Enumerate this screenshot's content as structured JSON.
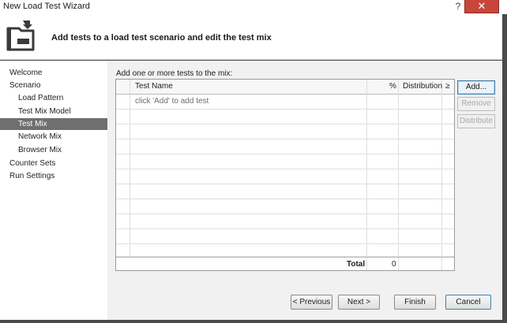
{
  "window": {
    "title": "New Load Test Wizard",
    "help_glyph": "?",
    "close_glyph": "✕"
  },
  "header": {
    "heading": "Add tests to a load test scenario and edit the test mix",
    "icon": "wizard-folder-arrow-icon"
  },
  "nav": {
    "items": [
      {
        "label": "Welcome",
        "level": 0,
        "selected": false
      },
      {
        "label": "Scenario",
        "level": 0,
        "selected": false
      },
      {
        "label": "Load Pattern",
        "level": 1,
        "selected": false
      },
      {
        "label": "Test Mix Model",
        "level": 1,
        "selected": false
      },
      {
        "label": "Test Mix",
        "level": 1,
        "selected": true
      },
      {
        "label": "Network Mix",
        "level": 1,
        "selected": false
      },
      {
        "label": "Browser Mix",
        "level": 1,
        "selected": false
      },
      {
        "label": "Counter Sets",
        "level": 0,
        "selected": false
      },
      {
        "label": "Run Settings",
        "level": 0,
        "selected": false
      }
    ]
  },
  "mix": {
    "instruction": "Add one or more tests to the mix:",
    "columns": {
      "name": "Test Name",
      "percent": "%",
      "distribution": "Distribution",
      "sort": "≥"
    },
    "placeholder": "click 'Add' to add test",
    "total_label": "Total",
    "total_value": "0"
  },
  "side_buttons": {
    "add": "Add...",
    "remove": "Remove",
    "distribute": "Distribute"
  },
  "footer": {
    "previous": "< Previous",
    "next": "Next >",
    "finish": "Finish",
    "cancel": "Cancel"
  },
  "colors": {
    "selected_nav": "#6f6f6f",
    "close_button": "#c7463b",
    "focus_border": "#3c7fb1"
  }
}
